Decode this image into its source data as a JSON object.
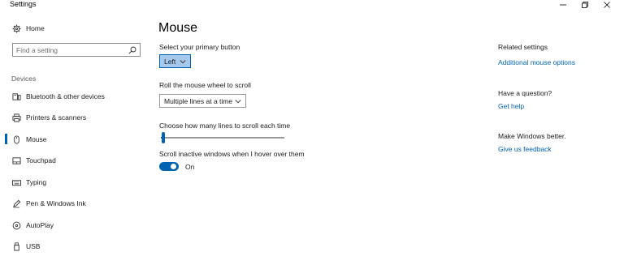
{
  "window": {
    "title": "Settings",
    "controls": [
      "minimize",
      "maximize",
      "close"
    ]
  },
  "sidebar": {
    "home_label": "Home",
    "search": {
      "placeholder": "Find a setting",
      "value": ""
    },
    "section_label": "Devices",
    "items": [
      {
        "label": "Bluetooth & other devices",
        "icon": "bluetooth-devices-icon"
      },
      {
        "label": "Printers & scanners",
        "icon": "printer-icon"
      },
      {
        "label": "Mouse",
        "icon": "mouse-icon",
        "active": true
      },
      {
        "label": "Touchpad",
        "icon": "touchpad-icon"
      },
      {
        "label": "Typing",
        "icon": "keyboard-icon"
      },
      {
        "label": "Pen & Windows Ink",
        "icon": "pen-icon"
      },
      {
        "label": "AutoPlay",
        "icon": "autoplay-icon"
      },
      {
        "label": "USB",
        "icon": "usb-icon"
      }
    ]
  },
  "main": {
    "title": "Mouse",
    "primary_button": {
      "label": "Select your primary button",
      "value": "Left"
    },
    "scroll_wheel": {
      "label": "Roll the mouse wheel to scroll",
      "value": "Multiple lines at a time"
    },
    "lines_slider": {
      "label": "Choose how many lines to scroll each time",
      "fraction": 0.02
    },
    "inactive_scroll": {
      "label": "Scroll inactive windows when I hover over them",
      "state_text": "On",
      "on": true
    }
  },
  "right": {
    "related_heading": "Related settings",
    "related_link": "Additional mouse options",
    "question_heading": "Have a question?",
    "help_link": "Get help",
    "better_heading": "Make Windows better.",
    "feedback_link": "Give us feedback"
  },
  "colors": {
    "accent": "#0063b1",
    "selected_bg": "#a5c8ec"
  }
}
